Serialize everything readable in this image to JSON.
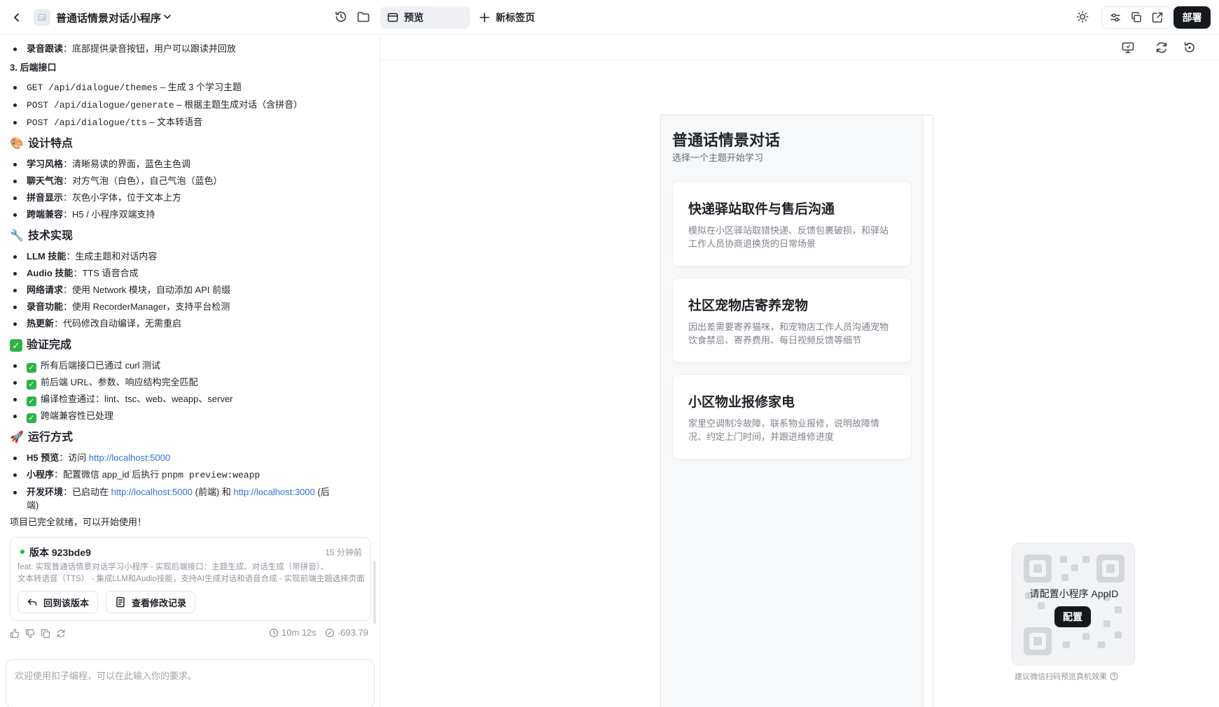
{
  "topbar": {
    "title": "普通话情景对话小程序",
    "tab_preview": "预览",
    "tab_new": "新标签页",
    "deploy_label": "部署"
  },
  "chat": {
    "line_record": {
      "label": "录音跟读",
      "text": "：底部提供录音按钮，用户可以跟读并回放"
    },
    "section_backend": "3. 后端接口",
    "api": [
      {
        "code": "GET /api/dialogue/themes",
        "text": " – 生成 3 个学习主题"
      },
      {
        "code": "POST /api/dialogue/generate",
        "text": " – 根据主题生成对话（含拼音）"
      },
      {
        "code": "POST /api/dialogue/tts",
        "text": " – 文本转语音"
      }
    ],
    "design": {
      "emoji": "🎨",
      "heading": "设计特点",
      "items": [
        {
          "label": "学习风格",
          "text": "：清晰易读的界面，蓝色主色调"
        },
        {
          "label": "聊天气泡",
          "text": "：对方气泡（白色），自己气泡（蓝色）"
        },
        {
          "label": "拼音显示",
          "text": "：灰色小字体，位于文本上方"
        },
        {
          "label": "跨端兼容",
          "text": "：H5 / 小程序双端支持"
        }
      ]
    },
    "tech": {
      "emoji": "🔧",
      "heading": "技术实现",
      "items": [
        {
          "label": "LLM 技能",
          "text": "：生成主题和对话内容"
        },
        {
          "label": "Audio 技能",
          "text": "：TTS 语音合成"
        },
        {
          "label": "网络请求",
          "text": "：使用 Network 模块，自动添加 API 前缀"
        },
        {
          "label": "录音功能",
          "text": "：使用 RecorderManager，支持平台检测"
        },
        {
          "label": "热更新",
          "text": "：代码修改自动编译，无需重启"
        }
      ]
    },
    "verify": {
      "heading": "验证完成",
      "items": [
        "所有后端接口已通过 curl 测试",
        "前后端 URL、参数、响应结构完全匹配",
        "编译检查通过：lint、tsc、web、weapp、server",
        "跨端兼容性已处理"
      ]
    },
    "run": {
      "emoji": "🚀",
      "heading": "运行方式",
      "h5_label": "H5 预览",
      "h5_text": "：访问 ",
      "h5_link": "http://localhost:5000",
      "mp_label": "小程序",
      "mp_text": "：配置微信 app_id 后执行 ",
      "mp_code": "pnpm preview:weapp",
      "dev_label": "开发环境",
      "dev_text1": "：已启动在 ",
      "dev_link1": "http://localhost:5000",
      "dev_text2": " (前端) 和 ",
      "dev_link2": "http://localhost:3000",
      "dev_text3": " (后",
      "dev_text4": "端)"
    },
    "ready": "项目已完全就绪，可以开始使用！",
    "version": {
      "title": "版本 923bde9",
      "time": "15 分钟前",
      "desc1": "feat: 实现普通话情景对话学习小程序 - 实现后端接口：主题生成、对话生成（带拼音）、",
      "desc2": "文本转语音（TTS） - 集成LLM和Audio技能，支持AI生成对话和语音合成 - 实现前端主题选择页面",
      "revert_label": "回到该版本",
      "changes_label": "查看修改记录"
    },
    "meta": {
      "duration": "10m 12s",
      "cost": "-693.79"
    },
    "input_placeholder": "欢迎使用扣子编程，可以在此输入你的要求。"
  },
  "phone": {
    "title": "普通话情景对话",
    "subtitle": "选择一个主题开始学习",
    "themes": [
      {
        "title": "快递驿站取件与售后沟通",
        "desc": "模拟在小区驿站取错快递、反馈包裹破损，和驿站工作人员协商退换货的日常场景"
      },
      {
        "title": "社区宠物店寄养宠物",
        "desc": "因出差需要寄养猫咪，和宠物店工作人员沟通宠物饮食禁忌、寄养费用、每日视频反馈等细节"
      },
      {
        "title": "小区物业报修家电",
        "desc": "家里空调制冷故障，联系物业报修，说明故障情况、约定上门时间，并跟进维修进度"
      }
    ]
  },
  "qr": {
    "label": "请配置小程序 AppID",
    "button": "配置",
    "tip": "建议微信扫码预览真机效果"
  }
}
